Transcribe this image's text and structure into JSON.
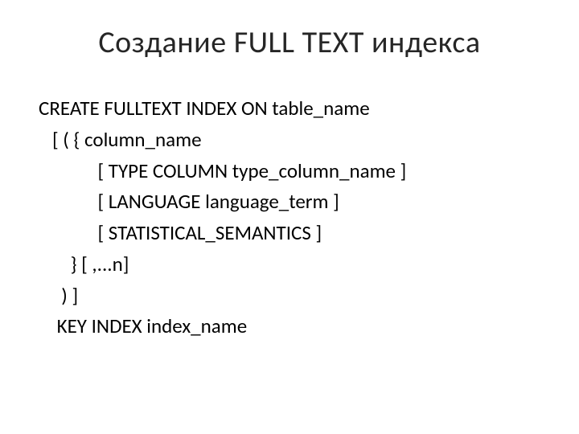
{
  "slide": {
    "title": "Создание FULL TEXT индекса",
    "lines": [
      "CREATE FULLTEXT INDEX ON table_name",
      "   [ ( { column_name",
      "             [ TYPE COLUMN type_column_name ]",
      "             [ LANGUAGE language_term ]",
      "             [ STATISTICAL_SEMANTICS ]",
      "       } [ ,...n]",
      "     ) ]",
      "    KEY INDEX index_name"
    ]
  }
}
